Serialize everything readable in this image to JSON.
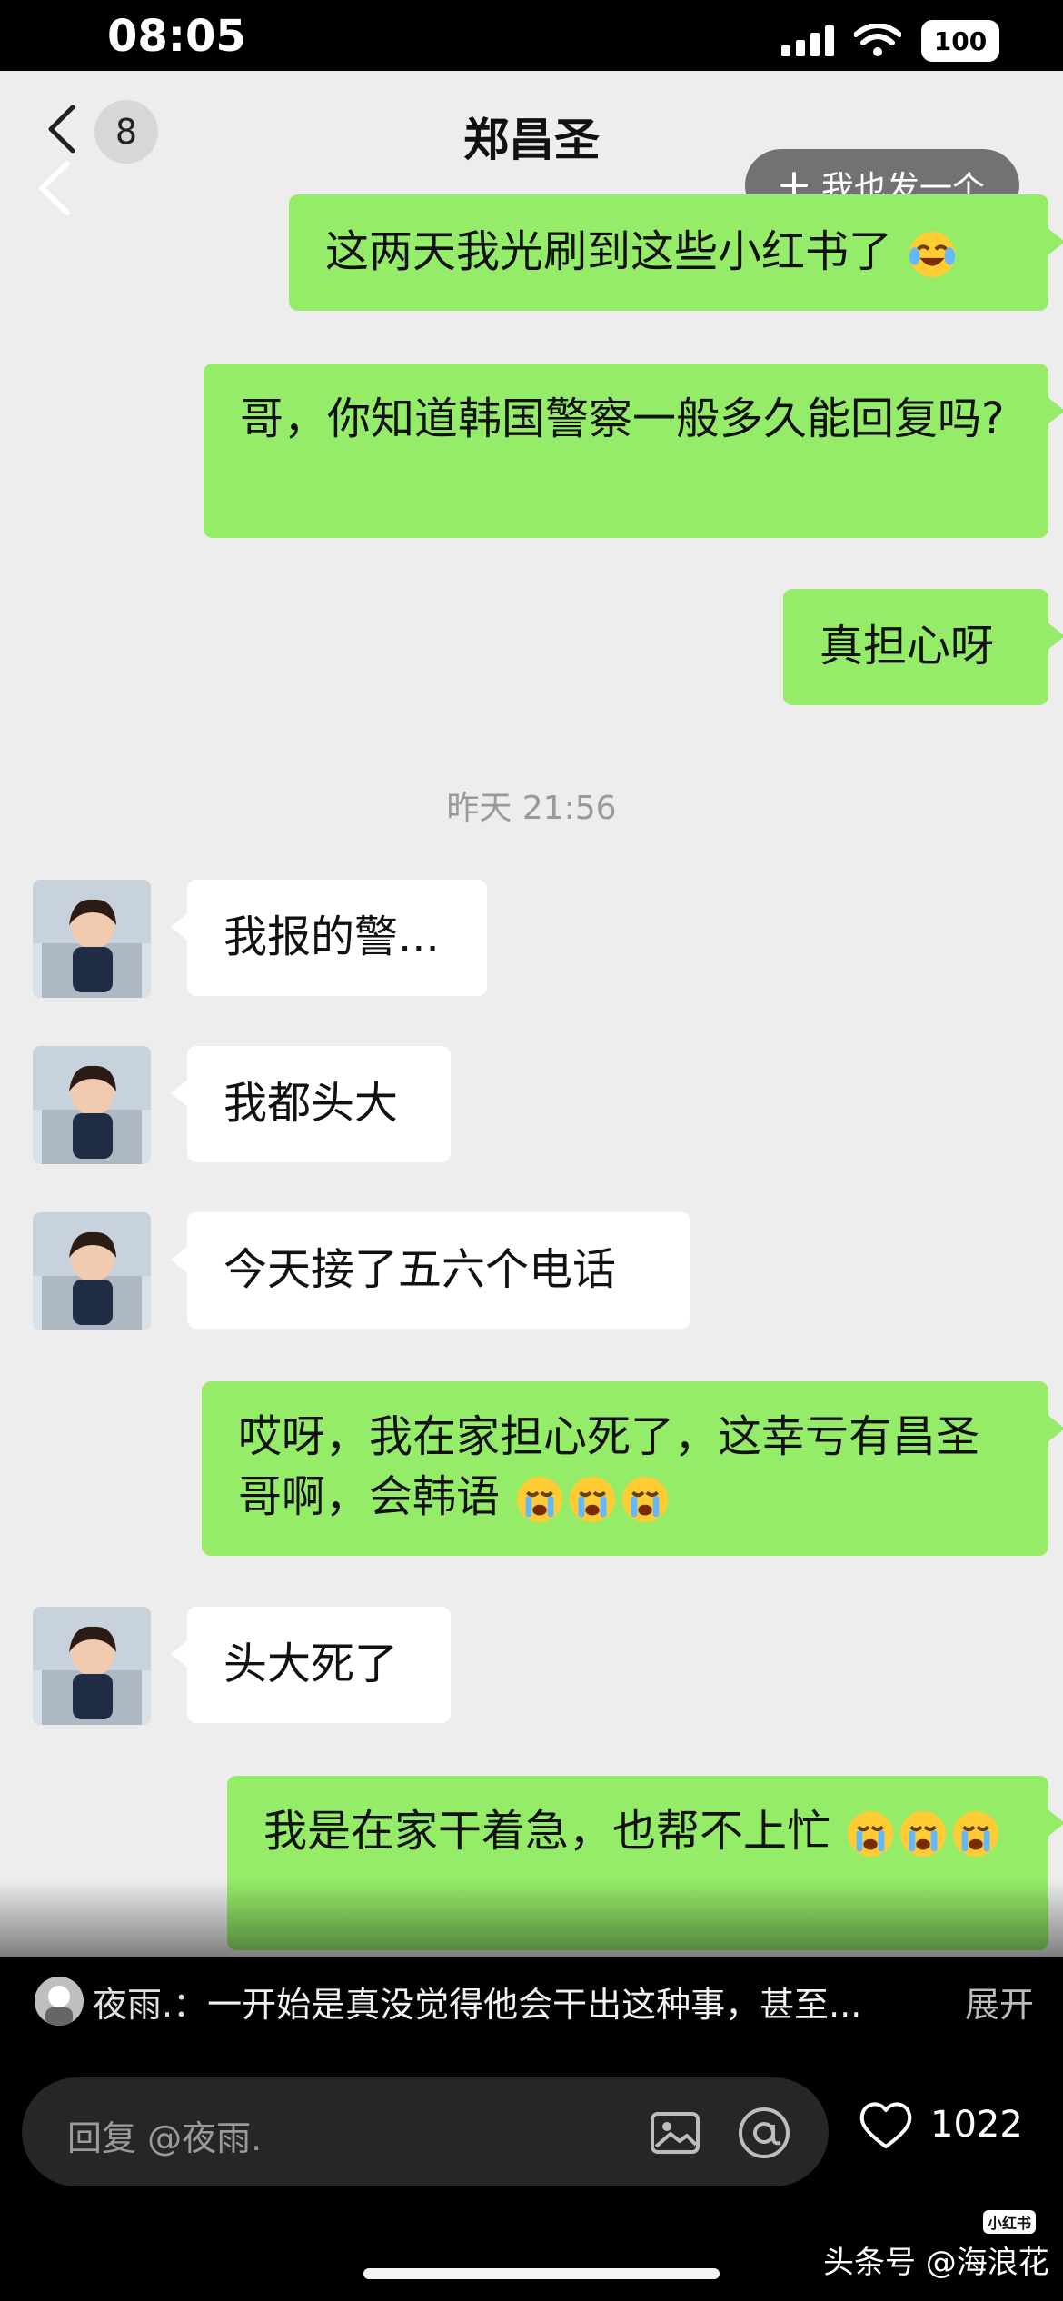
{
  "status_bar": {
    "time": "08:05",
    "battery": "100"
  },
  "chat": {
    "contact_name": "郑昌圣",
    "unread_count": "8",
    "post_also_label": "我也发一个",
    "timestamp": "昨天 21:56",
    "messages": [
      {
        "direction": "out",
        "text": "这两天我光刷到这些小红书了",
        "emoji": "laugh-cry-emoji"
      },
      {
        "direction": "out",
        "text": "哥，你知道韩国警察一般多久能回复吗?"
      },
      {
        "direction": "out",
        "text": "真担心呀"
      },
      {
        "direction": "in",
        "text": "我报的警..."
      },
      {
        "direction": "in",
        "text": "我都头大"
      },
      {
        "direction": "in",
        "text": "今天接了五六个电话"
      },
      {
        "direction": "out",
        "text": "哎呀，我在家担心死了，这幸亏有昌圣哥啊，会韩语",
        "emoji": "crying-emoji-x3"
      },
      {
        "direction": "in",
        "text": "头大死了"
      },
      {
        "direction": "out",
        "text": "我是在家干着急，也帮不上忙",
        "emoji": "crying-emoji-x3"
      }
    ]
  },
  "comment": {
    "author": "夜雨.",
    "colon": "：",
    "text": "一开始是真没觉得他会干出这种事，甚至...",
    "expand_label": "展开"
  },
  "reply_bar": {
    "placeholder": "回复 @夜雨."
  },
  "likes": {
    "count": "1022"
  },
  "watermark": {
    "text": "头条号 @海浪花",
    "badge": "小红书"
  }
}
